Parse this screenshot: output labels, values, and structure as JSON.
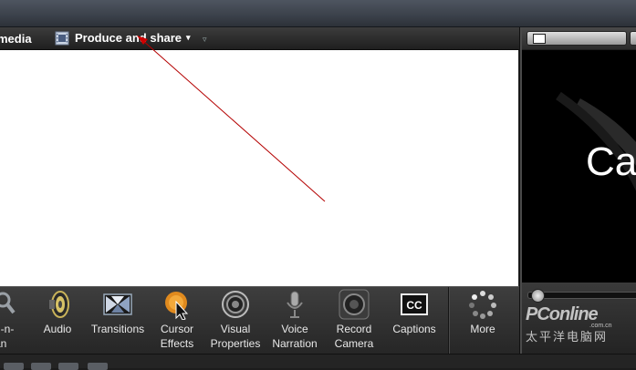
{
  "toolbar": {
    "media_label": "media",
    "produce_label": "Produce and share",
    "produce_caret": "▾",
    "options_caret": "▿"
  },
  "tasks": [
    {
      "id": "zoom",
      "label": "n-n-\nan",
      "icon": "zoom-magnifier-icon"
    },
    {
      "id": "audio",
      "label": "Audio",
      "icon": "speaker-icon"
    },
    {
      "id": "transitions",
      "label": "Transitions",
      "icon": "transitions-icon"
    },
    {
      "id": "cursor_effects",
      "label": "Cursor\nEffects",
      "icon": "cursor-effects-icon"
    },
    {
      "id": "visual_properties",
      "label": "Visual\nProperties",
      "icon": "visual-properties-icon"
    },
    {
      "id": "voice_narration",
      "label": "Voice\nNarration",
      "icon": "microphone-icon"
    },
    {
      "id": "record_camera",
      "label": "Record\nCamera",
      "icon": "camera-icon"
    },
    {
      "id": "captions",
      "label": "Captions",
      "icon": "captions-cc-icon"
    },
    {
      "id": "more",
      "label": "More",
      "icon": "more-spinner-icon"
    }
  ],
  "preview": {
    "text": "Ca"
  },
  "watermark": {
    "main": "PConline",
    "sub": ".com.cn",
    "cn": "太平洋电脑网"
  },
  "colors": {
    "canvas": "#ffffff",
    "annotation_line": "#b40000",
    "toolbar": "#2b2b2b"
  }
}
